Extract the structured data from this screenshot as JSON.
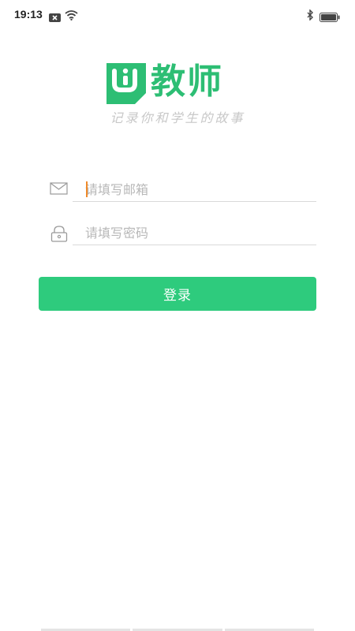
{
  "status_bar": {
    "time": "19:13"
  },
  "logo": {
    "badge_letters": "Ui",
    "word": "教师",
    "slogan": "记录你和学生的故事",
    "brand_color": "#2dbe74"
  },
  "form": {
    "email": {
      "value": "",
      "placeholder": "请填写邮箱",
      "icon": "mail-icon"
    },
    "password": {
      "value": "",
      "placeholder": "请填写密码",
      "icon": "lock-icon"
    },
    "login_label": "登录",
    "button_color": "#2ecb7d"
  }
}
